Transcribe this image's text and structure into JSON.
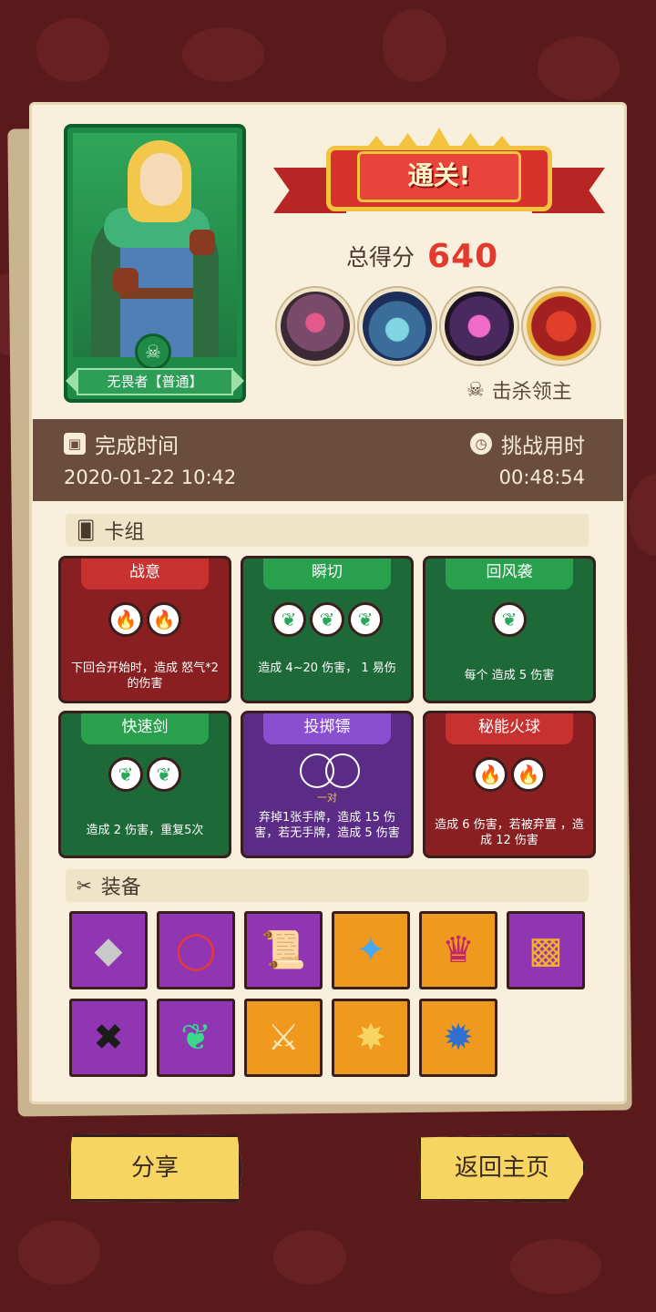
{
  "result": {
    "banner": "通关!",
    "score_label": "总得分",
    "score_value": "640",
    "kill_lord_label": "击杀领主"
  },
  "hero": {
    "name": "无畏者【普通】"
  },
  "time": {
    "complete_label": "完成时间",
    "complete_value": "2020-01-22 10:42",
    "challenge_label": "挑战用时",
    "challenge_value": "00:48:54"
  },
  "deck": {
    "title": "卡组",
    "cards": [
      {
        "name": "战意",
        "color": "red",
        "orbs": [
          "fire",
          "fire"
        ],
        "desc": "下回合开始时，造成 怒气*2 的伤害"
      },
      {
        "name": "瞬切",
        "color": "green",
        "orbs": [
          "leaf",
          "leaf",
          "leaf"
        ],
        "desc": "造成 4~20 伤害， 1 易伤"
      },
      {
        "name": "回风袭",
        "color": "green",
        "orbs": [
          "leaf"
        ],
        "desc": "每个 造成 5 伤害"
      },
      {
        "name": "快速剑",
        "color": "green",
        "orbs": [
          "leaf",
          "leaf"
        ],
        "desc": "造成 2 伤害，重复5次"
      },
      {
        "name": "投掷镖",
        "color": "purple",
        "orbs": [],
        "pair_label": "一对",
        "desc": "弃掉1张手牌，造成 15 伤害，若无手牌，造成 5 伤害"
      },
      {
        "name": "秘能火球",
        "color": "red",
        "orbs": [
          "fire",
          "fire"
        ],
        "desc": "造成 6 伤害，若被弃置 ，造成 12 伤害"
      }
    ]
  },
  "equipment": {
    "title": "装备",
    "items": [
      {
        "icon": "diamond-shard-icon",
        "color": "purple"
      },
      {
        "icon": "red-ring-icon",
        "color": "purple"
      },
      {
        "icon": "scroll-icon",
        "color": "purple"
      },
      {
        "icon": "blue-crystal-icon",
        "color": "orange"
      },
      {
        "icon": "crown-helm-icon",
        "color": "orange"
      },
      {
        "icon": "fire-cube-icon",
        "color": "purple"
      },
      {
        "icon": "dark-cube-icon",
        "color": "purple"
      },
      {
        "icon": "green-leaf-gem-icon",
        "color": "purple"
      },
      {
        "icon": "winged-sword-icon",
        "color": "orange"
      },
      {
        "icon": "trophy-badge-icon",
        "color": "orange"
      },
      {
        "icon": "spiked-orb-icon",
        "color": "orange"
      }
    ]
  },
  "buttons": {
    "share": "分享",
    "home": "返回主页"
  }
}
